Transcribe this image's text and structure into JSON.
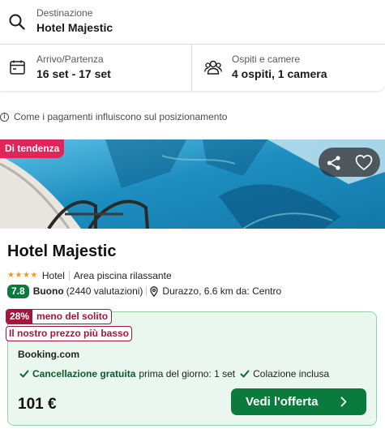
{
  "search": {
    "destination_label": "Destinazione",
    "destination_value": "Hotel Majestic",
    "dates_label": "Arrivo/Partenza",
    "dates_value": "16 set - 17 set",
    "guests_label": "Ospiti e camere",
    "guests_value": "4 ospiti, 1 camera"
  },
  "info_note": "Come i pagamenti influiscono sul posizionamento",
  "hotel": {
    "trend_badge": "Di tendenza",
    "name": "Hotel Majestic",
    "stars": 4,
    "type": "Hotel",
    "highlight": "Area piscina rilassante",
    "score": "7.8",
    "rating_word": "Buono",
    "reviews": "(2440 valutazioni)",
    "location": "Durazzo, 6.6 km da: Centro"
  },
  "offer": {
    "discount_pct": "28%",
    "discount_text": "meno del solito",
    "lowest_price_badge": "Il nostro prezzo più basso",
    "provider": "Booking.com",
    "free_cancel": "Cancellazione gratuita",
    "free_cancel_detail": "prima del giorno: 1 set",
    "breakfast": "Colazione inclusa",
    "price": "101 €",
    "cta_label": "Vedi l'offerta"
  },
  "colors": {
    "trend": "#e3245a",
    "score_bg": "#0b7a3e",
    "discount": "#a3163f",
    "offer_bg": "#e9f7ee",
    "cta_bg": "#0a7b3d",
    "stars": "#f29a1b"
  },
  "icons": [
    "search-icon",
    "calendar-icon",
    "people-icon",
    "info-icon",
    "share-icon",
    "heart-icon",
    "star-icon",
    "map-pin-icon",
    "check-icon",
    "chevron-right-icon"
  ]
}
